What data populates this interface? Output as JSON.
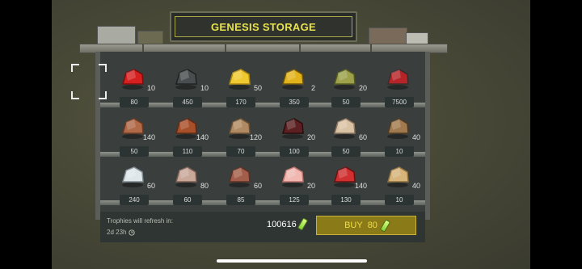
{
  "header": {
    "title": "GENESIS STORAGE"
  },
  "shelves": [
    [
      {
        "name": "red-gas-can-icon",
        "qty": "10",
        "price": "80"
      },
      {
        "name": "metal-sheet-icon",
        "qty": "10",
        "price": "450"
      },
      {
        "name": "yellow-fabric-icon",
        "qty": "50",
        "price": "170"
      },
      {
        "name": "oil-filter-icon",
        "qty": "2",
        "price": "350"
      },
      {
        "name": "jerrycan-icon",
        "qty": "20",
        "price": "50"
      },
      {
        "name": "red-backpack-icon",
        "qty": "",
        "price": "7500"
      }
    ],
    [
      {
        "name": "copper-ore-icon",
        "qty": "140",
        "price": "50"
      },
      {
        "name": "rust-ore-icon",
        "qty": "140",
        "price": "110"
      },
      {
        "name": "fiber-bundle-icon",
        "qty": "120",
        "price": "70"
      },
      {
        "name": "dark-ore-pile-icon",
        "qty": "20",
        "price": "100"
      },
      {
        "name": "cloth-icon",
        "qty": "60",
        "price": "50"
      },
      {
        "name": "log-icon",
        "qty": "40",
        "price": "10"
      }
    ],
    [
      {
        "name": "white-crystals-icon",
        "qty": "60",
        "price": "240"
      },
      {
        "name": "quartz-icon",
        "qty": "80",
        "price": "60"
      },
      {
        "name": "hide-icon",
        "qty": "60",
        "price": "85"
      },
      {
        "name": "pink-crystals-icon",
        "qty": "20",
        "price": "125"
      },
      {
        "name": "red-mushroom-icon",
        "qty": "140",
        "price": "130"
      },
      {
        "name": "sand-pile-icon",
        "qty": "40",
        "price": "10"
      }
    ]
  ],
  "footer": {
    "refresh_label": "Trophies will refresh in:",
    "refresh_time": "2d 23h",
    "balance": "100616",
    "buy_label": "BUY",
    "buy_price": "80"
  },
  "colors": {
    "accent": "#e8e34a",
    "buy_bg": "#8a7a18"
  }
}
